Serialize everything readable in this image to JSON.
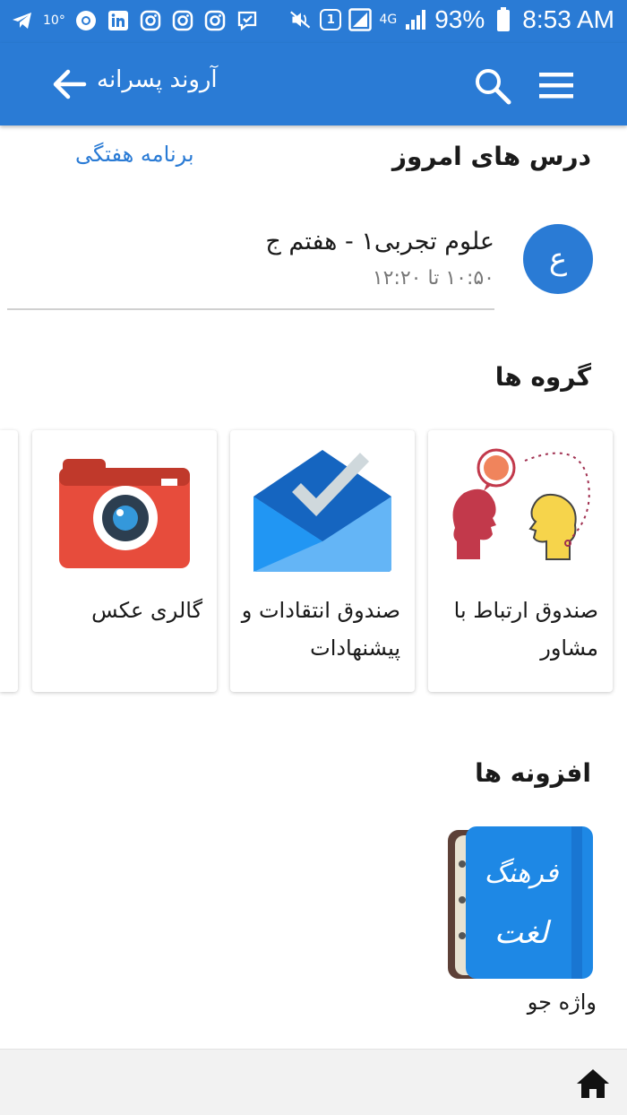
{
  "status_bar": {
    "temperature": "10°",
    "sim_label": "1",
    "network": "4G",
    "battery": "93%",
    "time": "8:53 AM"
  },
  "app_bar": {
    "title": "آروند پسرانه",
    "search_icon": "search-icon",
    "menu_icon": "hamburger-menu-icon",
    "back_icon": "arrow-left-icon"
  },
  "today": {
    "heading": "درس های امروز",
    "weekly_link": "برنامه هفتگی",
    "lessons": [
      {
        "avatar_letter": "ع",
        "title": "علوم تجربی۱ - هفتم ج",
        "time": "۱۰:۵۰ تا ۱۲:۲۰"
      }
    ]
  },
  "groups": {
    "heading": "گروه ها",
    "items": [
      {
        "label": "صندوق ارتباط با مشاور",
        "icon": "counselor-chat-icon"
      },
      {
        "label": "صندوق انتقادات و پیشنهادات",
        "icon": "inbox-check-icon"
      },
      {
        "label": "گالری عکس",
        "icon": "camera-icon"
      }
    ]
  },
  "addons": {
    "heading": "افزونه ها",
    "items": [
      {
        "label": "واژه جو",
        "icon": "dictionary-book-icon",
        "cover_text_1": "فرهنگ",
        "cover_text_2": "لغت"
      }
    ]
  },
  "bottom_bar": {
    "home_icon": "home-icon"
  },
  "colors": {
    "primary": "#2a7bd5",
    "camera_red": "#e74c3c",
    "envelope_blue": "#1e88e5"
  }
}
